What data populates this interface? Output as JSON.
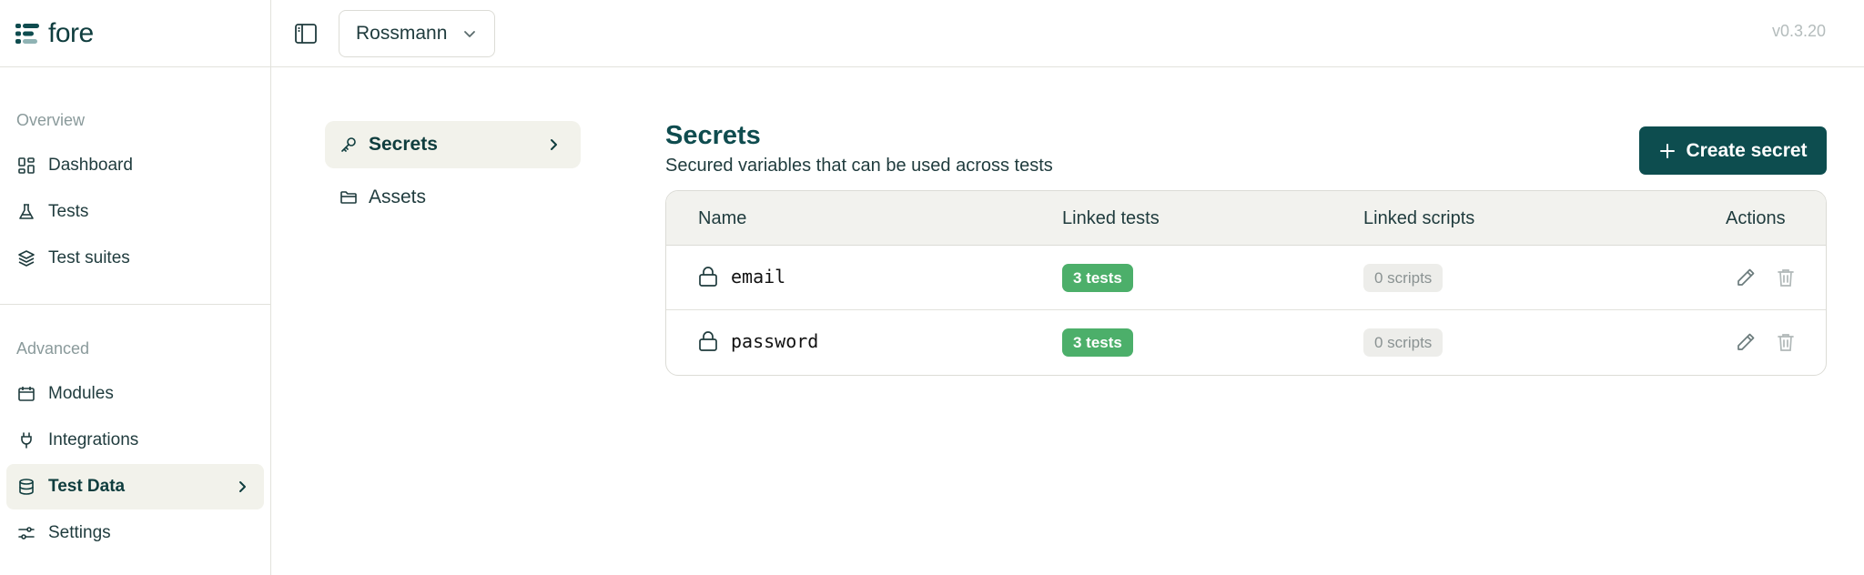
{
  "brand": {
    "name": "fore"
  },
  "sidebar": {
    "sections": [
      {
        "heading": "Overview",
        "items": [
          {
            "label": "Dashboard",
            "icon": "dashboard-icon"
          },
          {
            "label": "Tests",
            "icon": "flask-icon"
          },
          {
            "label": "Test suites",
            "icon": "layers-icon"
          }
        ]
      },
      {
        "heading": "Advanced",
        "items": [
          {
            "label": "Modules",
            "icon": "calendar-icon"
          },
          {
            "label": "Integrations",
            "icon": "plug-icon"
          },
          {
            "label": "Test Data",
            "icon": "database-icon",
            "active": true
          },
          {
            "label": "Settings",
            "icon": "sliders-icon"
          }
        ]
      }
    ]
  },
  "topbar": {
    "project": "Rossmann",
    "version": "v0.3.20"
  },
  "subnav": {
    "items": [
      {
        "label": "Secrets",
        "icon": "key-icon",
        "active": true
      },
      {
        "label": "Assets",
        "icon": "folder-icon"
      }
    ]
  },
  "main": {
    "title": "Secrets",
    "subtitle": "Secured variables that can be used across tests",
    "create_label": "Create secret"
  },
  "table": {
    "headers": [
      "Name",
      "Linked tests",
      "Linked scripts",
      "Actions"
    ],
    "rows": [
      {
        "name": "email",
        "linked_tests": "3 tests",
        "linked_scripts": "0 scripts"
      },
      {
        "name": "password",
        "linked_tests": "3 tests",
        "linked_scripts": "0 scripts"
      }
    ]
  },
  "colors": {
    "brand": "#0d4d4f",
    "badge_green": "#4caf6a",
    "active_bg": "#f2f2eb"
  }
}
